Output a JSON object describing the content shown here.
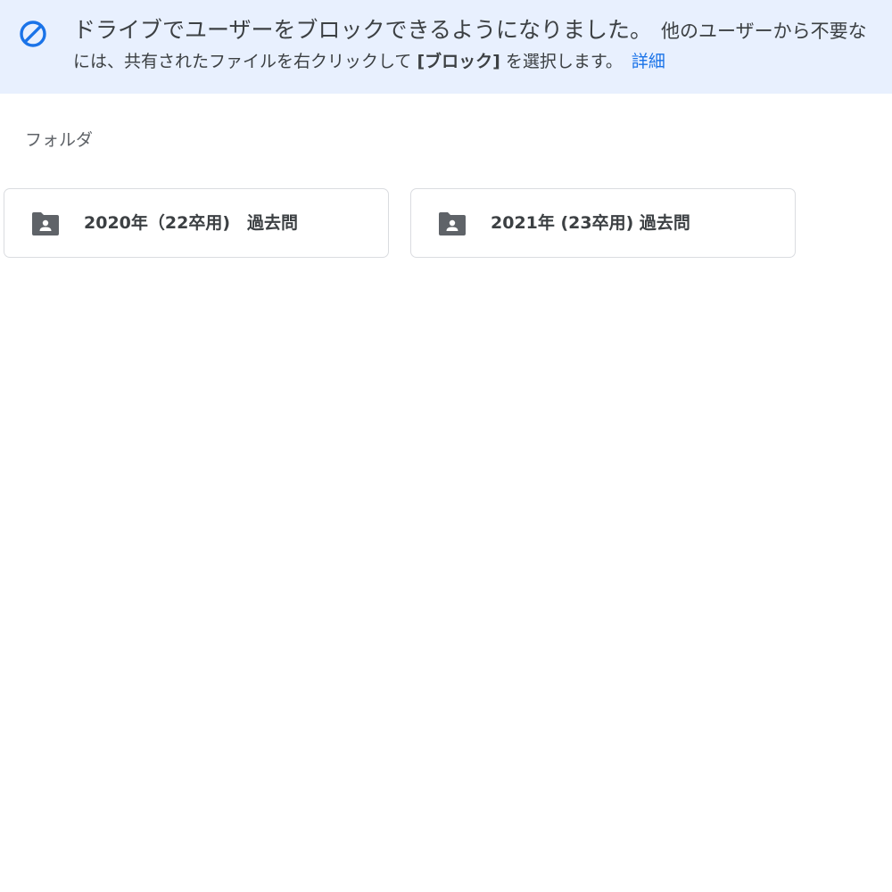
{
  "banner": {
    "icon": "block-icon",
    "icon_color": "#1a73e8",
    "background": "#e8f0fe",
    "line1_main": "ドライブでユーザーをブロックできるようになりました。",
    "line1_extra": "他のユーザーから不要な",
    "line2_prefix": "には、共有されたファイルを右クリックして",
    "line2_bold": "[ブロック]",
    "line2_suffix": "を選択します。",
    "details_link": "詳細",
    "link_color": "#1a73e8"
  },
  "section": {
    "label": "フォルダ"
  },
  "folders": [
    {
      "name": "2020年（22卒用)　過去問",
      "icon": "shared-folder-icon"
    },
    {
      "name": "2021年 (23卒用) 過去問",
      "icon": "shared-folder-icon"
    }
  ]
}
